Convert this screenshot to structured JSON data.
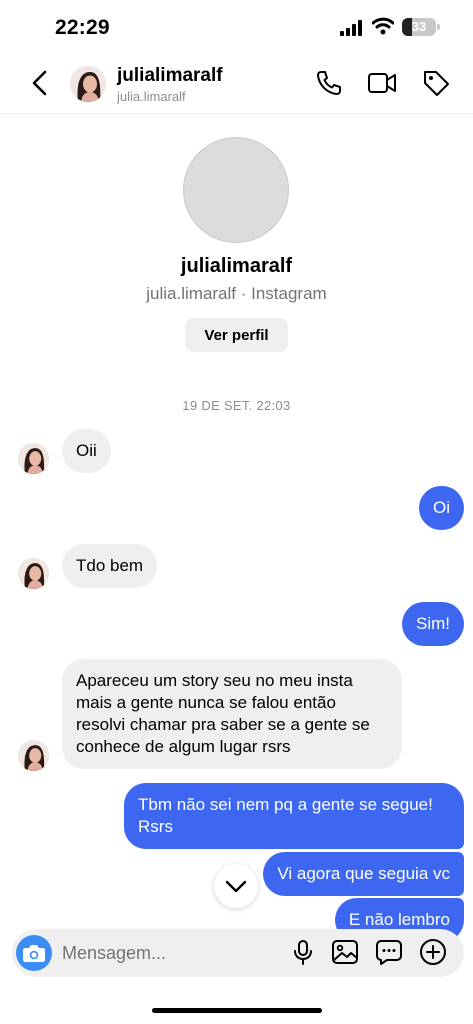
{
  "status_bar": {
    "time": "22:29",
    "battery": "33"
  },
  "header": {
    "name": "julialimaralf",
    "username": "julia.limaralf"
  },
  "profile": {
    "name": "julialimaralf",
    "subtitle": "julia.limaralf · Instagram",
    "view_profile_label": "Ver perfil"
  },
  "thread": {
    "date": "19 DE SET. 22:03",
    "messages": [
      {
        "direction": "in",
        "text": "Oii"
      },
      {
        "direction": "out",
        "text": "Oi"
      },
      {
        "direction": "in",
        "text": "Tdo bem"
      },
      {
        "direction": "out",
        "text": "Sim!"
      },
      {
        "direction": "in",
        "text": "Apareceu um story seu no meu insta mais a gente nunca se falou então resolvi chamar pra saber se a gente se conhece de algum lugar rsrs"
      },
      {
        "direction": "out",
        "text": "Tbm não sei nem pq a gente se segue! Rsrs"
      },
      {
        "direction": "out",
        "text": "Vi agora que seguia vc"
      },
      {
        "direction": "out",
        "text": "E não lembro"
      }
    ]
  },
  "composer": {
    "placeholder": "Mensagem..."
  },
  "colors": {
    "accent": "#3d67f0",
    "camera": "#3a8df5",
    "incoming_bubble": "#efefef"
  },
  "icons": {
    "header": [
      "back-icon",
      "phone-icon",
      "video-icon",
      "tag-icon"
    ],
    "composer": [
      "camera-icon",
      "microphone-icon",
      "image-icon",
      "sticker-icon",
      "plus-icon"
    ]
  }
}
